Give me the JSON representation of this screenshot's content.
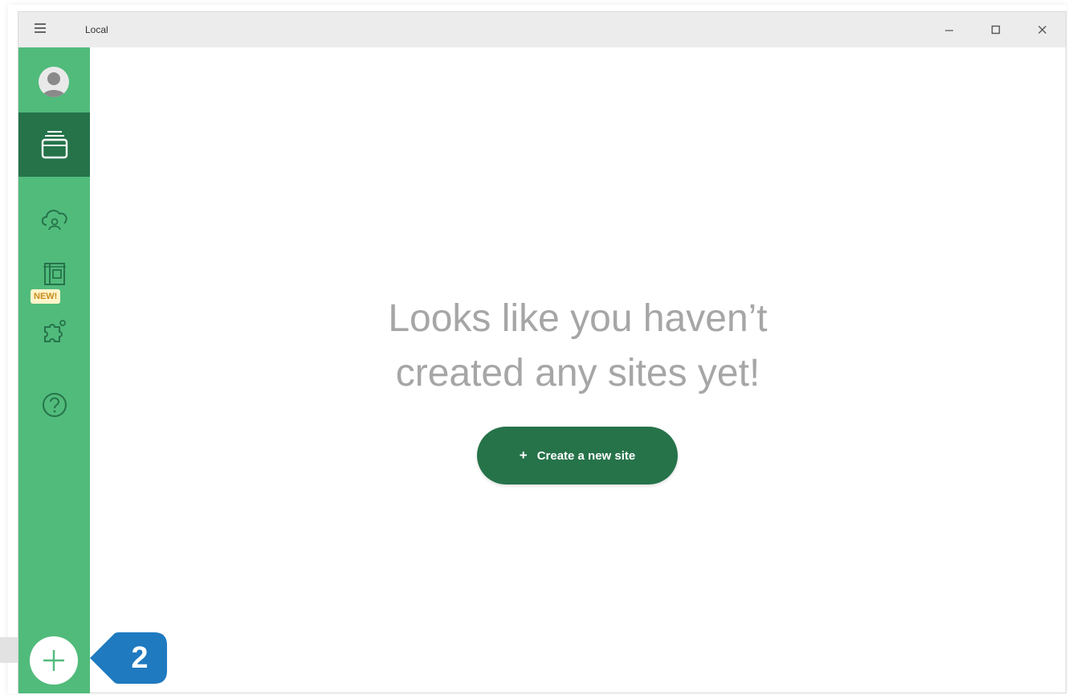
{
  "window": {
    "title": "Local",
    "controls": {
      "minimize": "–",
      "maximize": "□",
      "close": "✕"
    }
  },
  "sidebar": {
    "items": [
      {
        "name": "sites",
        "icon": "sites-stack-icon"
      },
      {
        "name": "connect",
        "icon": "cloud-connect-icon"
      },
      {
        "name": "blueprints",
        "icon": "blueprints-icon"
      },
      {
        "name": "add-ons",
        "icon": "puzzle-add-ons-icon"
      },
      {
        "name": "help",
        "icon": "help-question-icon"
      }
    ],
    "new_badge": "NEW!",
    "add_button": "+"
  },
  "main": {
    "empty_line1": "Looks like you haven’t",
    "empty_line2": "created any sites yet!",
    "create_button_plus": "+",
    "create_button_label": "Create a new site"
  },
  "callout": {
    "number": "2",
    "color": "#1f7ac0"
  },
  "colors": {
    "sidebar": "#51bb7b",
    "sidebar_active": "#26734a",
    "primary_button": "#26734a",
    "message_text": "#a6a6a6"
  }
}
